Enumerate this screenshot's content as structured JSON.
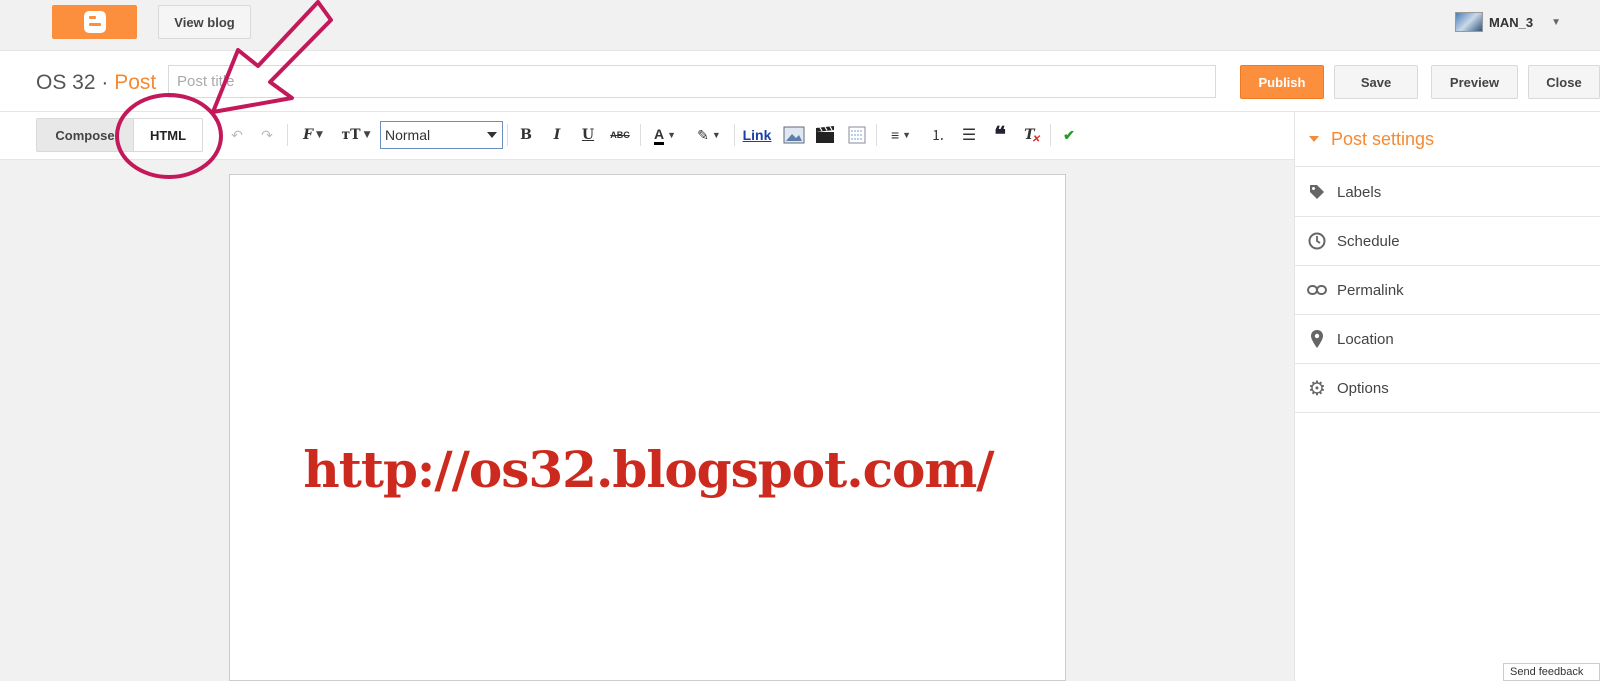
{
  "topbar": {
    "logo_icon": "blogger-logo-icon",
    "view_blog_label": "View blog",
    "user_name": "MAN_3"
  },
  "header": {
    "blog_name": "OS 32",
    "separator": "·",
    "page_label": "Post",
    "title_placeholder": "Post title",
    "publish_label": "Publish",
    "save_label": "Save",
    "preview_label": "Preview",
    "close_label": "Close"
  },
  "toolbar": {
    "compose_label": "Compose",
    "html_label": "HTML",
    "font_size_value": "Normal",
    "link_label": "Link",
    "icons": [
      "undo-icon",
      "redo-icon",
      "font-icon",
      "text-size-icon",
      "bold-icon",
      "italic-icon",
      "underline-icon",
      "strikethrough-icon",
      "text-color-icon",
      "highlight-icon",
      "image-icon",
      "video-icon",
      "jump-break-icon",
      "align-icon",
      "numbered-list-icon",
      "bullet-list-icon",
      "quote-icon",
      "remove-format-icon",
      "spellcheck-icon"
    ]
  },
  "editor": {
    "content": "http://os32.blogspot.com/"
  },
  "sidebar": {
    "header": "Post settings",
    "items": [
      {
        "label": "Labels",
        "icon": "tag-icon"
      },
      {
        "label": "Schedule",
        "icon": "clock-icon"
      },
      {
        "label": "Permalink",
        "icon": "link-icon"
      },
      {
        "label": "Location",
        "icon": "pin-icon"
      },
      {
        "label": "Options",
        "icon": "gear-icon"
      }
    ]
  },
  "footer": {
    "feedback_label": "Send feedback"
  },
  "colors": {
    "accent": "#fb8f3d",
    "post_text": "#cc2a1e",
    "annotation": "#c3185a"
  }
}
